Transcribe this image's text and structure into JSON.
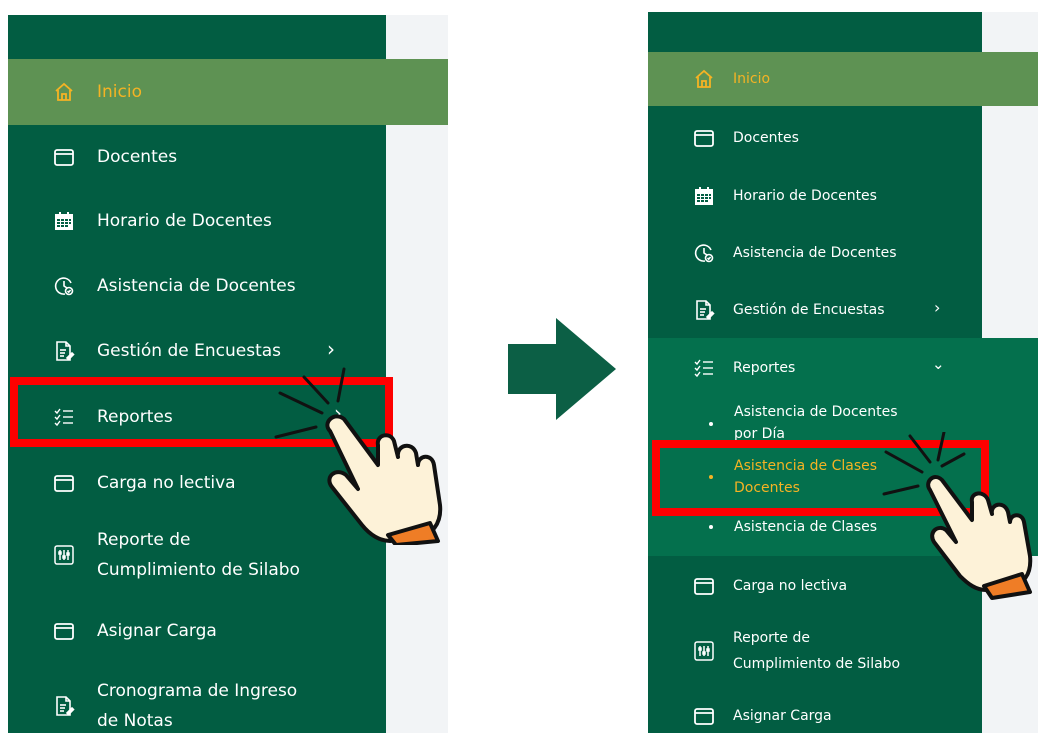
{
  "colors": {
    "sidebar_bg": "#025d42",
    "active_bg": "#5e9253",
    "active_text": "#f5b324",
    "submenu_bg": "#04704d",
    "highlight_red": "#fe0000",
    "arrow": "#0c5f45"
  },
  "left_menu": {
    "items": [
      {
        "label": "Inicio",
        "icon": "home-icon",
        "active": true
      },
      {
        "label": "Docentes",
        "icon": "window-icon"
      },
      {
        "label": "Horario de Docentes",
        "icon": "calendar-icon"
      },
      {
        "label": "Asistencia de Docentes",
        "icon": "clock-check-icon"
      },
      {
        "label": "Gestión de Encuestas",
        "icon": "survey-doc-icon",
        "chevron": "›"
      },
      {
        "label": "Reportes",
        "icon": "checklist-icon",
        "chevron": "›"
      },
      {
        "label": "Carga no lectiva",
        "icon": "window-icon"
      },
      {
        "label": "Reporte de",
        "label2": "Cumplimiento de Silabo",
        "icon": "sliders-icon"
      },
      {
        "label": "Asignar Carga",
        "icon": "window-icon"
      },
      {
        "label": "Cronograma de Ingreso",
        "label2": "de Notas",
        "icon": "survey-doc-icon"
      }
    ]
  },
  "right_menu": {
    "items": [
      {
        "label": "Inicio",
        "icon": "home-icon",
        "active": true
      },
      {
        "label": "Docentes",
        "icon": "window-icon"
      },
      {
        "label": "Horario de Docentes",
        "icon": "calendar-icon"
      },
      {
        "label": "Asistencia de Docentes",
        "icon": "clock-check-icon"
      },
      {
        "label": "Gestión de Encuestas",
        "icon": "survey-doc-icon",
        "chevron": "›"
      },
      {
        "label": "Reportes",
        "icon": "checklist-icon",
        "chevron": "⌄"
      },
      {
        "label": "Carga no lectiva",
        "icon": "window-icon"
      },
      {
        "label": "Reporte de",
        "label2": "Cumplimiento de Silabo",
        "icon": "sliders-icon"
      },
      {
        "label": "Asignar Carga",
        "icon": "window-icon"
      }
    ],
    "submenu": [
      {
        "label": "Asistencia de Docentes",
        "label2": "por Día"
      },
      {
        "label": "Asistencia de Clases",
        "label2": "Docentes",
        "active": true
      },
      {
        "label": "Asistencia de Clases"
      }
    ]
  }
}
